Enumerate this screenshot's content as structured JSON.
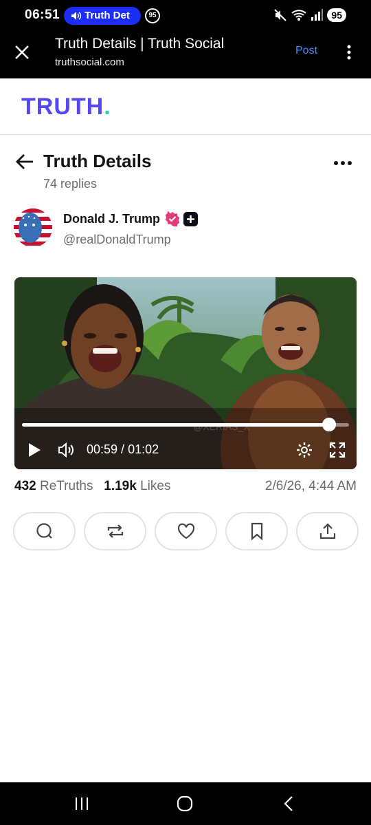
{
  "status_bar": {
    "time": "06:51",
    "call_pill_label": "Truth Det",
    "notification_badge": "95",
    "battery": "95"
  },
  "browser": {
    "title": "Truth Details | Truth Social",
    "url": "truthsocial.com",
    "post_label": "Post"
  },
  "site": {
    "logo_text": "TRUTH",
    "logo_dot": ".",
    "brand_color": "#5448ee",
    "accent_color": "#2ad3b3"
  },
  "page": {
    "title": "Truth Details",
    "replies": "74 replies"
  },
  "post": {
    "author_name": "Donald J. Trump",
    "handle": "@realDonaldTrump",
    "video": {
      "current_time": "00:59",
      "duration": "01:02",
      "progress_fraction": 0.94,
      "watermark": "@XERIAS_X"
    },
    "retruths_count": "432",
    "retruths_label": "ReTruths",
    "likes_count": "1.19k",
    "likes_label": "Likes",
    "timestamp": "2/6/26, 4:44 AM"
  },
  "actions": [
    "reply-icon",
    "retruth-icon",
    "like-icon",
    "bookmark-icon",
    "share-icon"
  ]
}
